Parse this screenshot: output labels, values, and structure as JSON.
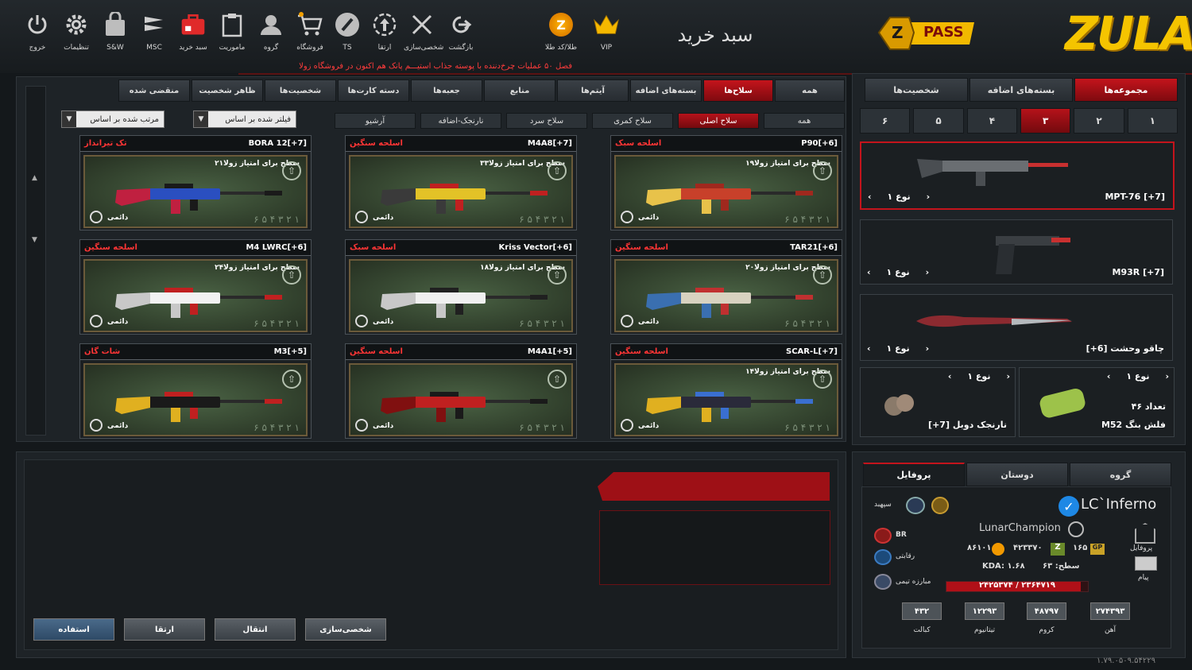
{
  "topbar": {
    "icons": [
      {
        "label": "خروج",
        "icon": "power-icon"
      },
      {
        "label": "تنظیمات",
        "icon": "gear-icon"
      },
      {
        "label": "S&W",
        "icon": "bag-icon"
      },
      {
        "label": "MSC",
        "icon": "msc-icon"
      },
      {
        "label": "سبد خرید",
        "icon": "cart-case-icon"
      },
      {
        "label": "ماموریت",
        "icon": "clipboard-icon"
      },
      {
        "label": "گروه",
        "icon": "group-icon"
      },
      {
        "label": "فروشگاه",
        "icon": "shop-cart-icon"
      },
      {
        "label": "TS",
        "icon": "teamspeak-icon"
      },
      {
        "label": "ارتقا",
        "icon": "upgrade-icon"
      },
      {
        "label": "شخصی‌سازی",
        "icon": "tools-icon"
      },
      {
        "label": "بازگشت",
        "icon": "back-icon"
      }
    ],
    "gold_label": "طلا/کد طلا",
    "gold_glyph": "Z",
    "vip_label": "VIP",
    "page_title": "سبد خرید",
    "pass_label": "PASS",
    "pass_glyph": "Z",
    "logo_text": "ZULA",
    "notice": "فصل ۵۰ عملیات چرخ‌دننده با پوسته جذاب استیـــم پانک هم اکنون در فروشگاه زولا"
  },
  "main": {
    "tabs": [
      "همه",
      "سلاح‌ها",
      "بسته‌های اضافه",
      "آیتم‌ها",
      "منابع",
      "جعبه‌ها",
      "دسته کارت‌ها",
      "شخصیت‌ها",
      "ظاهر شخصیت",
      "منقضی شده"
    ],
    "active_tab": "سلاح‌ها",
    "subtabs": [
      "همه",
      "سلاح اصلی",
      "سلاح کمری",
      "سلاح سرد",
      "نارنجک-اضافه",
      "آرشیو"
    ],
    "active_subtab": "سلاح اصلی",
    "filter_label": "فیلتر شده بر اساس",
    "sort_label": "مرتب شده بر اساس",
    "permanent_label": "دائمی",
    "level_digits": "۶ ۵ ۴ ۳ ۲ ۱",
    "cards": [
      {
        "name": "P90[+6]",
        "category": "اسلحه سبک",
        "level_text": "سطح برای امتیاز زولا۱۹",
        "colors": [
          "#c8402a",
          "#e8c24a",
          "#a0281e"
        ]
      },
      {
        "name": "M4A8[+7]",
        "category": "اسلحه سنگین",
        "level_text": "سطح برای امتیاز زولا۳۳",
        "colors": [
          "#e3c227",
          "#3a3a3a",
          "#c02020"
        ]
      },
      {
        "name": "BORA 12[+7]",
        "category": "تک تیرانداز",
        "level_text": "سطح برای امتیاز زولا۲۱",
        "colors": [
          "#2a4fc0",
          "#c02040",
          "#1a1a1a"
        ]
      },
      {
        "name": "TAR21[+6]",
        "category": "اسلحه سنگین",
        "level_text": "سطح برای امتیاز زولا۲۰",
        "colors": [
          "#d8d2c0",
          "#3a6fb0",
          "#c03030"
        ]
      },
      {
        "name": "Kriss Vector[+6]",
        "category": "اسلحه سبک",
        "level_text": "سطح برای امتیاز زولا۱۸",
        "colors": [
          "#f0f0f0",
          "#c8c8c8",
          "#202020"
        ]
      },
      {
        "name": "M4 LWRC[+6]",
        "category": "اسلحه سنگین",
        "level_text": "سطح برای امتیاز زولا۲۴",
        "colors": [
          "#f2f2f2",
          "#c8c8c8",
          "#c02020"
        ]
      },
      {
        "name": "SCAR-L[+7]",
        "category": "اسلحه سنگین",
        "level_text": "سطح برای امتیاز زولا۱۴",
        "colors": [
          "#2a2a3a",
          "#e0b020",
          "#3a6fd0"
        ]
      },
      {
        "name": "M4A1[+5]",
        "category": "اسلحه سنگین",
        "level_text": "",
        "colors": [
          "#c02020",
          "#801010",
          "#1a1a1a"
        ]
      },
      {
        "name": "M3[+5]",
        "category": "شات گان",
        "level_text": "",
        "colors": [
          "#1a1a1a",
          "#e0b020",
          "#c02020"
        ]
      }
    ]
  },
  "right": {
    "tabs": [
      "مجموعه‌ها",
      "بسته‌های اضافه",
      "شخصیت‌ها"
    ],
    "active_tab": "مجموعه‌ها",
    "numtabs": [
      "۱",
      "۲",
      "۳",
      "۴",
      "۵",
      "۶"
    ],
    "active_num": "۳",
    "items": [
      {
        "name": "MPT-76 [+7]",
        "type": "نوع ۱"
      },
      {
        "name": "M93R [+7]",
        "type": "نوع ۱"
      },
      {
        "name": "[+6] چاقو وحشت",
        "type": "نوع ۱"
      }
    ],
    "small_items": [
      {
        "name": "M52 فلش بنگ",
        "type": "نوع ۱",
        "count": "تعداد ۴۶"
      },
      {
        "name": "[+7] نارنجک دوبل",
        "type": "نوع ۱"
      }
    ]
  },
  "bottom": {
    "buttons": [
      "شخصی‌سازی",
      "انتقال",
      "ارتقا",
      "استفاده"
    ]
  },
  "profile": {
    "tabs": [
      "گروه",
      "دوستان",
      "پروفایل"
    ],
    "active_tab": "پروفایل",
    "player_name": "LC`Inferno",
    "rank": "سپهبد",
    "clan_name": "LunarChampion",
    "br_label": "BR",
    "competitive_label": "رقابتی",
    "team_label": "مبارزه تیمی",
    "gold": "۸۶۱۰۱",
    "zula_points": "۴۲۳۳۷۰",
    "gp": "۱۶۵",
    "level": "سطح: ۶۳",
    "kda": "KDA: ۱.۶۸",
    "xp": "۲۴۲۵۳۷۴ / ۲۳۶۴۷۱۹",
    "xp_progress": 0.95,
    "profile_label": "پروفایل",
    "message_label": "پیام",
    "resources": [
      {
        "value": "۲۷۴۳۹۳",
        "label": "آهن"
      },
      {
        "value": "۴۸۷۹۷",
        "label": "کروم"
      },
      {
        "value": "۱۲۲۹۳",
        "label": "تیتانیوم"
      },
      {
        "value": "۴۳۲",
        "label": "کبالت"
      }
    ]
  },
  "version": "۱.۷۹.۰۵۰۹.۵۴۲۲۹",
  "colors": {
    "accent": "#c4141c",
    "gold": "#f5c400",
    "panel": "#1e2327"
  }
}
